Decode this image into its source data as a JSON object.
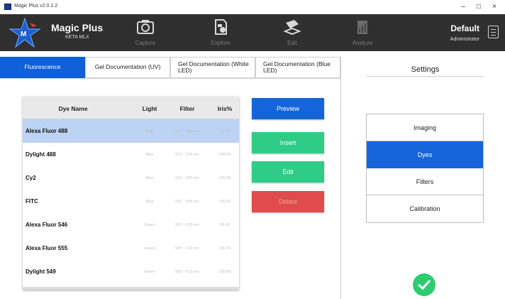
{
  "window": {
    "title": "Magic Plus v2.0.1.2",
    "controls": [
      "–",
      "□",
      "×"
    ]
  },
  "header": {
    "brand_name": "Magic Plus",
    "brand_sub": "KETA MLX",
    "logo_letter": "M",
    "nav": [
      {
        "label": "Capture",
        "icon": "camera-icon"
      },
      {
        "label": "Explore",
        "icon": "explore-image-icon"
      },
      {
        "label": "Edit",
        "icon": "edit-tool-icon"
      },
      {
        "label": "Analyze",
        "icon": "analyze-chart-icon"
      }
    ],
    "user_name": "Default",
    "user_role": "Administrator"
  },
  "tabs": [
    {
      "label": "Fluorescence",
      "active": true
    },
    {
      "label": "Gel Documentation (UV)",
      "active": false
    },
    {
      "label": "Gel Documentation (White LED)",
      "active": false
    },
    {
      "label": "Gel Documentation (Blue LED)",
      "active": false
    }
  ],
  "table": {
    "headers": [
      "Dye Name",
      "Light",
      "Filter",
      "Iris%"
    ],
    "rows": [
      {
        "name": "Alexa Fluor 488",
        "light": "Blue",
        "filter": "510 ~ 555 nm",
        "iris": "50.00",
        "selected": true
      },
      {
        "name": "Dylight 488",
        "light": "Blue",
        "filter": "510 ~ 555 nm",
        "iris": "100.00",
        "selected": false
      },
      {
        "name": "Cy2",
        "light": "Blue",
        "filter": "510 ~ 555 nm",
        "iris": "100.00",
        "selected": false
      },
      {
        "name": "FITC",
        "light": "Blue",
        "filter": "510 ~ 555 nm",
        "iris": "100.00",
        "selected": false
      },
      {
        "name": "Alexa Fluor 546",
        "light": "Green",
        "filter": "565 ~ 615 nm",
        "iris": "50.00",
        "selected": false
      },
      {
        "name": "Alexa Fluor 555",
        "light": "Green",
        "filter": "565 ~ 615 nm",
        "iris": "100.00",
        "selected": false
      },
      {
        "name": "Dylight 549",
        "light": "Green",
        "filter": "565 ~ 615 nm",
        "iris": "100.00",
        "selected": false
      }
    ]
  },
  "actions": {
    "preview": "Preview",
    "insert": "Insert",
    "edit": "Edit",
    "delete": "Delete"
  },
  "settings": {
    "title": "Settings",
    "items": [
      {
        "label": "Imaging",
        "active": false
      },
      {
        "label": "Dyes",
        "active": true
      },
      {
        "label": "Filters",
        "active": false
      },
      {
        "label": "Calibration",
        "active": false
      }
    ]
  },
  "colors": {
    "accent_blue": "#1565d8",
    "green": "#2ecc86",
    "red": "#e04c4c",
    "header_bg": "#2f2f2f",
    "selected_row": "#bcd3f2"
  }
}
